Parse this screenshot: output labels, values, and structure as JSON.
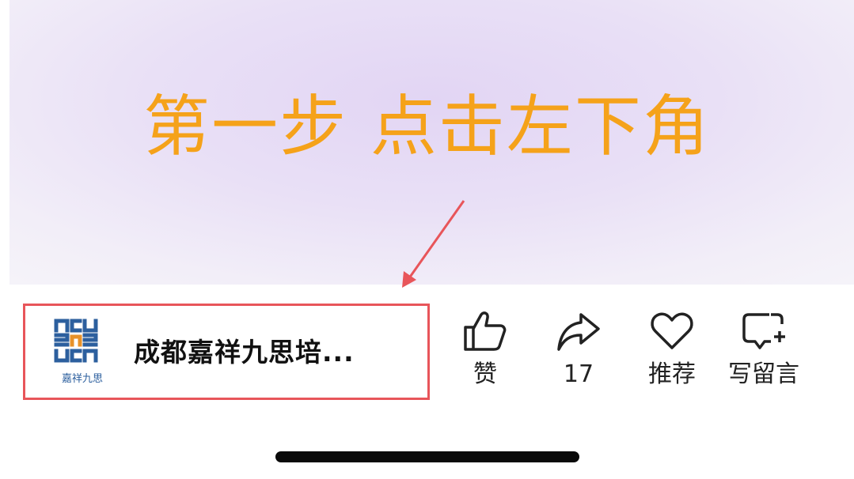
{
  "hero": {
    "headline": "第一步 点击左下角"
  },
  "account": {
    "logo_text": "嘉祥九思",
    "name": "成都嘉祥九思培..."
  },
  "actions": [
    {
      "id": "like",
      "icon": "thumbs-up-icon",
      "label": "赞"
    },
    {
      "id": "share",
      "icon": "share-arrow-icon",
      "label": "17"
    },
    {
      "id": "recommend",
      "icon": "heart-icon",
      "label": "推荐"
    },
    {
      "id": "comment",
      "icon": "comment-plus-icon",
      "label": "写留言"
    }
  ],
  "colors": {
    "headline": "#f5a21a",
    "highlight": "#e8555a",
    "logo_blue": "#2c5f9e",
    "logo_orange": "#e8922a"
  }
}
